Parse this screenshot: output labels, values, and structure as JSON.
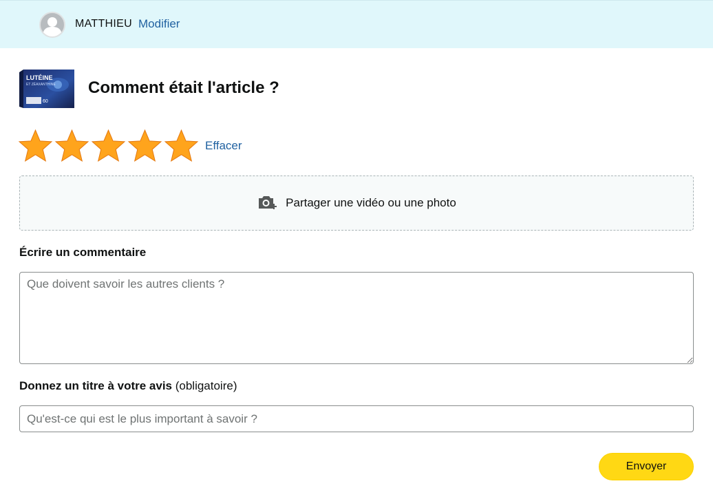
{
  "header": {
    "user_name": "MATTHIEU",
    "edit_label": "Modifier",
    "avatar_icon": "user-avatar-icon",
    "background": "#e0f7fb"
  },
  "product": {
    "image_text_line1": "LUTÉINE",
    "image_text_line2": "ET ZÉAXANTHINE",
    "image_icon": "product-box-image"
  },
  "main": {
    "title": "Comment était l'article ?",
    "rating": {
      "value": 5,
      "max": 5,
      "star_color": "#ffa41c"
    },
    "clear_label": "Effacer",
    "upload": {
      "label": "Partager une vidéo ou une photo",
      "icon": "camera-add-icon"
    },
    "comment": {
      "label": "Écrire un commentaire",
      "placeholder": "Que doivent savoir les autres clients ?",
      "value": ""
    },
    "review_title": {
      "label_bold": "Donnez un titre à votre avis",
      "label_suffix": " (obligatoire)",
      "placeholder": "Qu'est-ce qui est le plus important à savoir ?",
      "value": ""
    },
    "submit_label": "Envoyer",
    "accent_link": "#2162a1",
    "button_color": "#ffd814"
  }
}
